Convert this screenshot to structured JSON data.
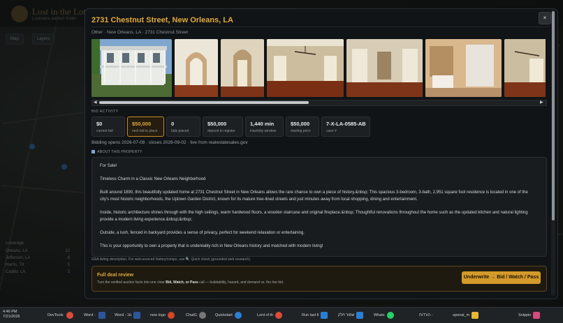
{
  "background": {
    "site_title": "Lost in the Lots",
    "site_subtitle": "Louisiana auction finder",
    "buttons": [
      "Map",
      "Layers"
    ],
    "coverage_title": "Coverage",
    "coverage_rows": [
      {
        "label": "Orleans, LA",
        "count": "12"
      },
      {
        "label": "Jefferson, LA",
        "count": "8"
      },
      {
        "label": "Harris, TX",
        "count": "5"
      },
      {
        "label": "Caddo, LA",
        "count": "3"
      }
    ]
  },
  "modal": {
    "title": "2731 Chestnut Street, New Orleans, LA",
    "close_label": "×",
    "breadcrumb": "Other · New Orleans, LA · 2731 Chestnut Street",
    "photos": [
      {
        "alt": "front-exterior-photo",
        "color": "#6b8fb8"
      },
      {
        "alt": "arched-doorway-photo",
        "color": "#b59b77"
      },
      {
        "alt": "hallway-photo",
        "color": "#c2b08f"
      },
      {
        "alt": "living-room-fan-photo",
        "color": "#a79678"
      },
      {
        "alt": "empty-room-photo",
        "color": "#bdb19c"
      },
      {
        "alt": "bathroom-photo",
        "color": "#c9a880"
      },
      {
        "alt": "bedroom-fan-photo",
        "color": "#b7a78c"
      }
    ],
    "bid_activity_label": "BID ACTIVITY",
    "stats": [
      {
        "value": "$0",
        "label": "current bid",
        "highlight": false
      },
      {
        "value": "$50,000",
        "label": "next bid to place",
        "highlight": true
      },
      {
        "value": "0",
        "label": "bids placed",
        "highlight": false
      },
      {
        "value": "$50,000",
        "label": "deposit to register",
        "highlight": false
      },
      {
        "value": "1,440 min",
        "label": "inactivity window",
        "highlight": false
      },
      {
        "value": "$50,000",
        "label": "starting price",
        "highlight": false
      },
      {
        "value": "7-X-LA-0585-AB",
        "label": "case #",
        "highlight": false
      }
    ],
    "bidding_line": "Bidding opens 2026-07-08 · closes 2026-09-02 · live from realestatesales.gov",
    "about_label": "ABOUT THIS PROPERTY",
    "about_paragraphs": [
      "For Sale!",
      "Timeless Charm in a Classic New Orleans Neighborhood",
      "Built around 1890, this beautifully updated home at 2731 Chestnut Street in New Orleans allows the rare chance to own a piece of history.&nbsp; This spacious 3-bedroom, 3-bath, 2,951 square foot residence is located in one of the city's most historic neighborhoods, the Uptown Garden District, known for its mature tree-lined streets and just minutes away from local shopping, dining and entertainment.",
      "Inside, historic architecture shines through with the high ceilings, warm hardwood floors, a wooden staircase and original fireplace.&nbsp; Thoughtful renovations throughout the home such as the updated kitchen and natural lighting provide a modern living experience.&nbsp;&nbsp;",
      "Outside, a lush, fenced in backyard provides a sense of privacy, perfect for weekend relaxation or entertaining.",
      "This is your opportunity to own a property that is undeniably rich in New Orleans history and matched with modern living!"
    ],
    "source_note": "GSA listing description. For web-sourced history/comps, use 🔍 Quick check (grounded web research).",
    "review": {
      "title": "Full deal review",
      "desc_prefix": "Turn the verified auction facts into one clear ",
      "desc_bold": "Bid, Watch, or Pass",
      "desc_suffix": " call — buildability, hazard, and demand vs. the live bid.",
      "button_label": "Underwrite → Bid / Watch / Pass"
    }
  },
  "taskbar": {
    "time": "4:46 PM",
    "date": "7/21/2026",
    "items": [
      {
        "label": "DevTools",
        "color": "#3b3f44"
      },
      {
        "label": "Word - ‏",
        "color": "#e8e8e8"
      },
      {
        "label": "Word - נוכ",
        "color": "#2b579a"
      },
      {
        "label": "new logo",
        "color": "#2b579a"
      },
      {
        "label": "ChatG",
        "color": "#d24726"
      },
      {
        "label": "Quickstart",
        "color": "#777"
      },
      {
        "label": "Lord of th",
        "color": "#2a7fd4"
      },
      {
        "label": "Run last fi",
        "color": "#444"
      },
      {
        "label": "שמור חלק",
        "color": "#2a7fd4"
      },
      {
        "label": "Whats",
        "color": "#2a7fd4"
      },
      {
        "label": "הורדות -",
        "color": "#25d366"
      },
      {
        "label": "openai_m",
        "color": "#1e90ff"
      },
      {
        "label": "Snippin",
        "color": "#e8b830"
      }
    ]
  }
}
